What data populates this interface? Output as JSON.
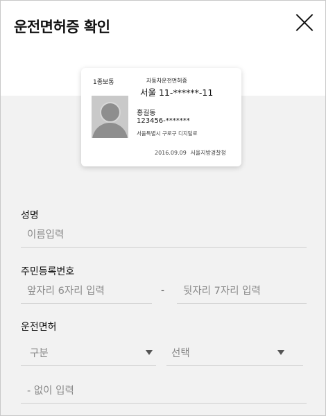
{
  "header": {
    "title": "운전면허증 확인"
  },
  "card": {
    "class": "1종보통",
    "title": "자동차운전면허증",
    "license_number": "서울 11-******-11",
    "name": "홍길동",
    "rrn": "123456-*******",
    "address": "서울특별시 구로구 디지털로",
    "issue_date": "2016.09.09",
    "issuer": "서울지방경찰청"
  },
  "form": {
    "name_label": "성명",
    "name_placeholder": "이름입력",
    "rrn_label": "주민등록번호",
    "rrn_front_placeholder": "앞자리 6자리 입력",
    "rrn_separator": "-",
    "rrn_back_placeholder": "뒷자리 7자리 입력",
    "license_label": "운전면허",
    "type_select": "구분",
    "region_select": "선택",
    "number_placeholder": "- 없이 입력"
  }
}
